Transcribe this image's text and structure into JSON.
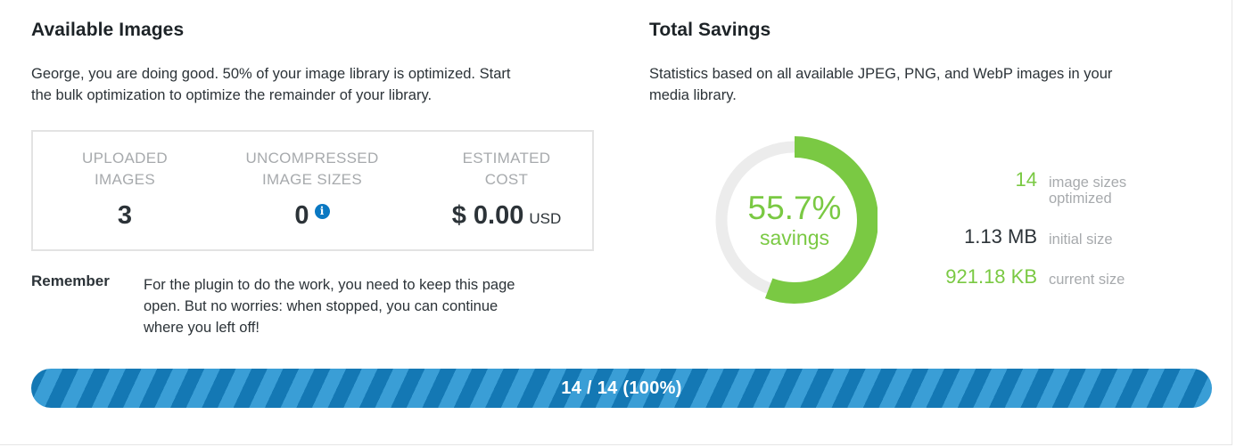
{
  "available_images": {
    "heading": "Available Images",
    "intro_line1": "George, you are doing good. 50% of your image library is optimized. Start",
    "intro_line2": "the bulk optimization to optimize the remainder of your library.",
    "stats": {
      "uploaded": {
        "label_line1": "UPLOADED",
        "label_line2": "IMAGES",
        "value": "3"
      },
      "uncompressed": {
        "label_line1": "UNCOMPRESSED",
        "label_line2": "IMAGE SIZES",
        "value": "0",
        "info_icon": "info-icon"
      },
      "cost": {
        "label_line1": "ESTIMATED",
        "label_line2": "COST",
        "value": "$ 0.00",
        "unit": "USD"
      }
    },
    "remember": {
      "label": "Remember",
      "text_line1": "For the plugin to do the work, you need to keep this page",
      "text_line2": "open. But no worries: when stopped, you can continue",
      "text_line3": "where you left off!"
    }
  },
  "total_savings": {
    "heading": "Total Savings",
    "intro_line1": "Statistics based on all available JPEG, PNG, and WebP images in your",
    "intro_line2": "media library.",
    "donut": {
      "percent_text": "55.7%",
      "sub_label": "savings",
      "fraction": 0.557,
      "color_fill": "#7ac943",
      "color_track": "#ececec"
    },
    "legend": [
      {
        "value": "14",
        "desc_line1": "image sizes",
        "desc_line2": "optimized",
        "color": "#7ac943"
      },
      {
        "value": "1.13 MB",
        "desc_line1": "initial size",
        "desc_line2": "",
        "color": "#2c3338"
      },
      {
        "value": "921.18 KB",
        "desc_line1": "current size",
        "desc_line2": "",
        "color": "#7ac943"
      }
    ]
  },
  "progress": {
    "text": "14 / 14 (100%)",
    "fraction": 1.0,
    "color": "#0a6ea8"
  }
}
